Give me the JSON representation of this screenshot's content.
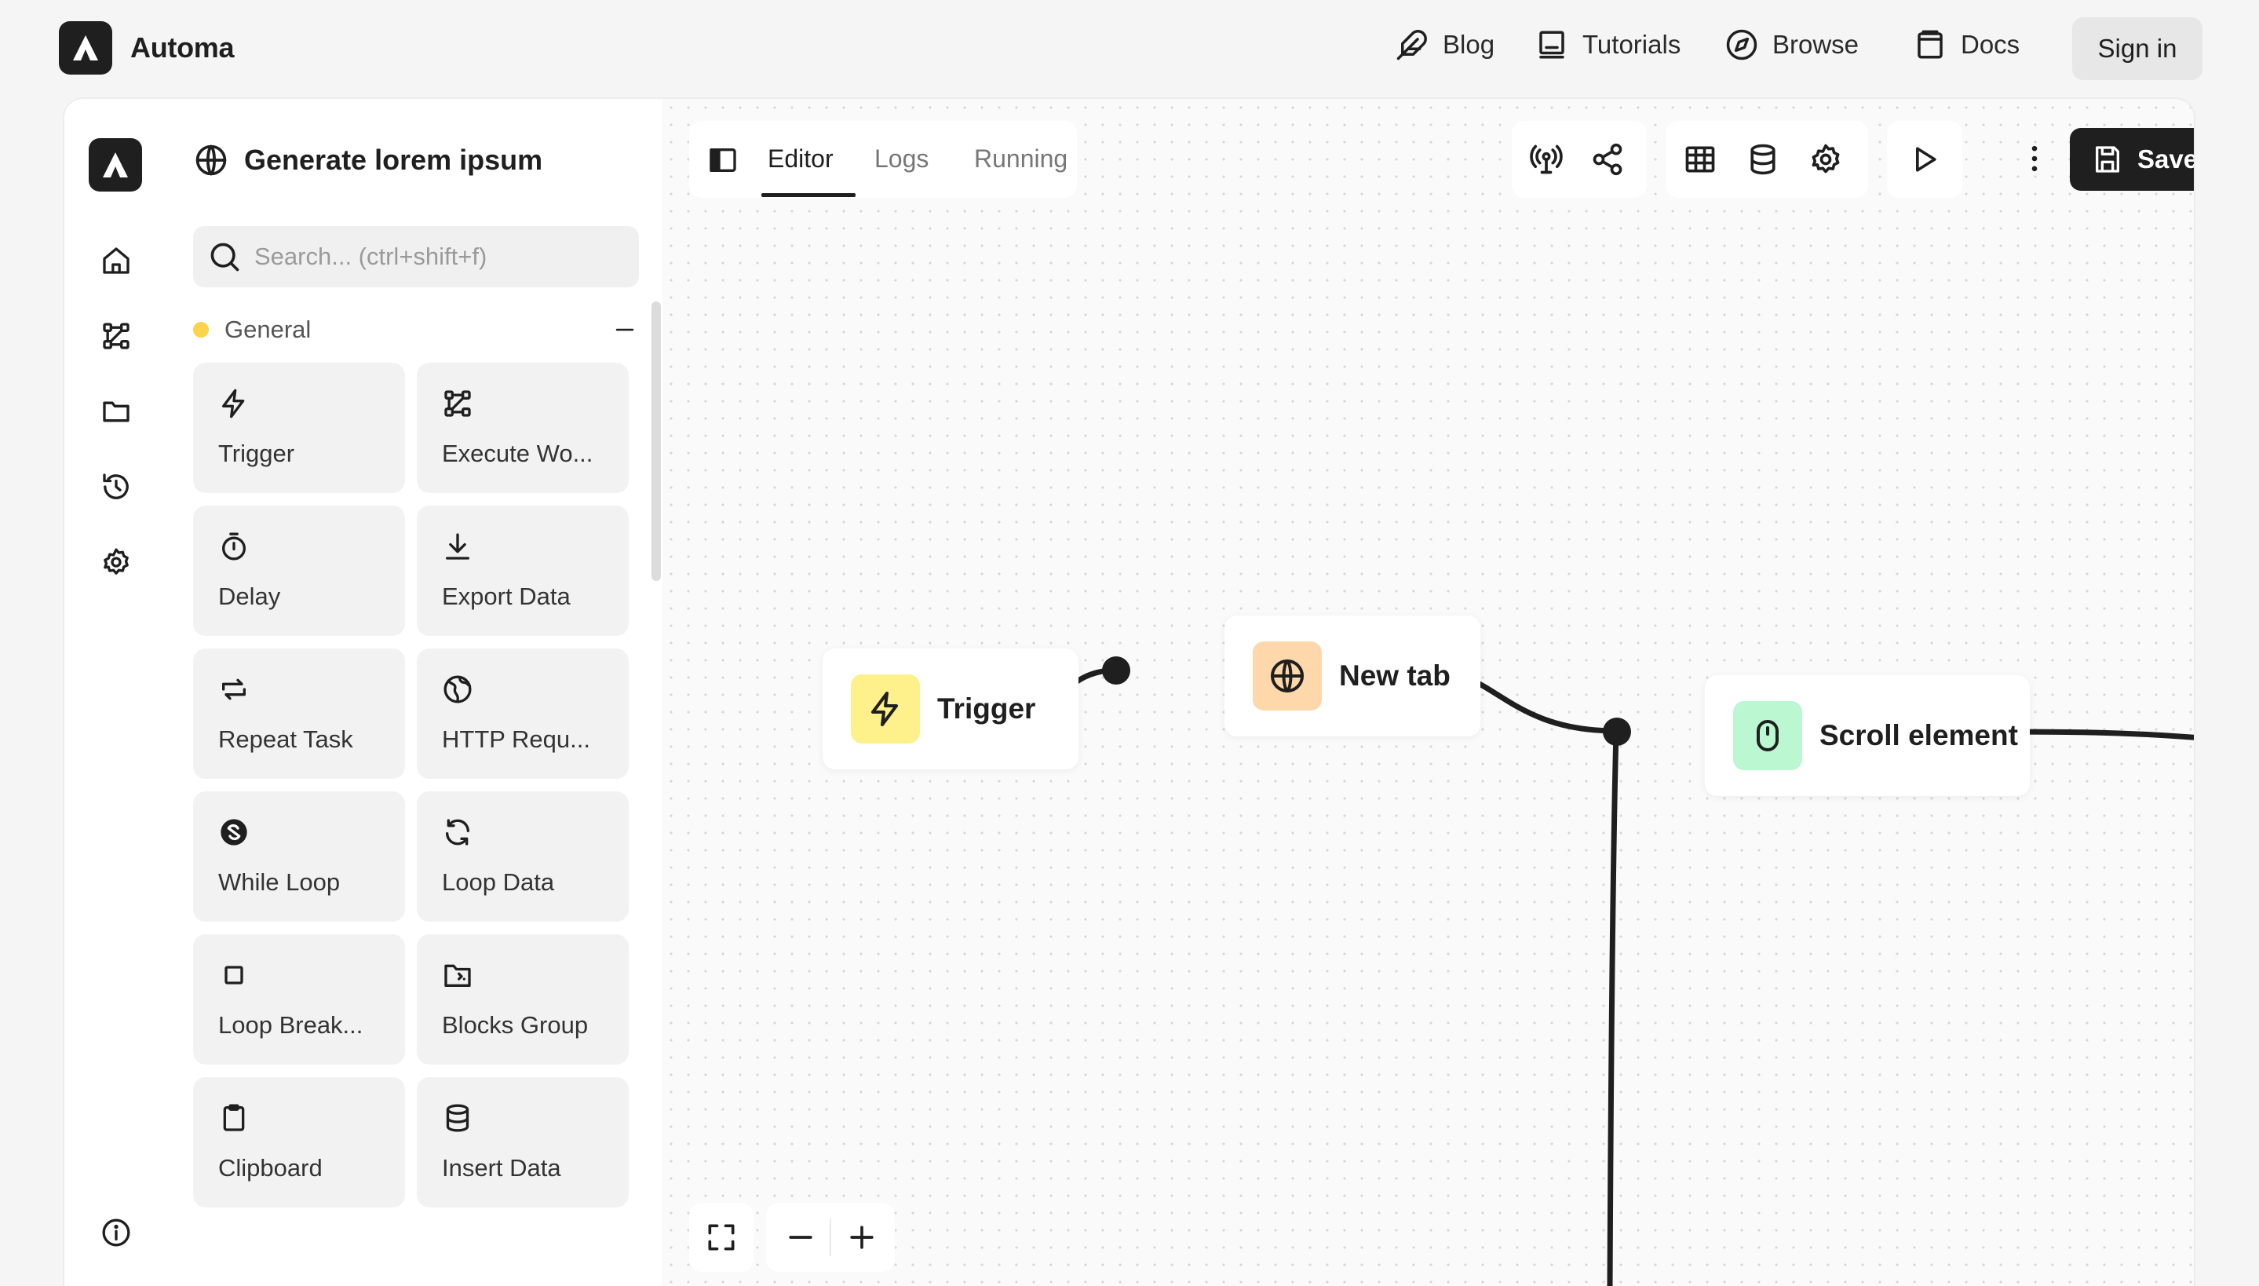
{
  "brand": {
    "name": "Automa"
  },
  "nav": {
    "links": [
      {
        "label": "Blog",
        "icon": "feather-icon"
      },
      {
        "label": "Tutorials",
        "icon": "book-icon"
      },
      {
        "label": "Browse",
        "icon": "compass-icon"
      },
      {
        "label": "Docs",
        "icon": "docs-icon"
      }
    ],
    "signin_label": "Sign in"
  },
  "sidebar": {
    "items": [
      {
        "name": "home",
        "icon": "home-icon"
      },
      {
        "name": "workflows",
        "icon": "workflow-icon"
      },
      {
        "name": "storage",
        "icon": "folder-icon"
      },
      {
        "name": "logs",
        "icon": "history-icon"
      },
      {
        "name": "settings",
        "icon": "gear-icon"
      },
      {
        "name": "about",
        "icon": "info-icon"
      }
    ]
  },
  "workflow": {
    "title": "Generate lorem ipsum"
  },
  "blocks_panel": {
    "search_placeholder": "Search... (ctrl+shift+f)",
    "category": {
      "label": "General",
      "color": "#fcd34d"
    },
    "blocks": [
      {
        "label": "Trigger",
        "icon": "bolt-icon"
      },
      {
        "label": "Execute Wo...",
        "icon": "workflow-icon"
      },
      {
        "label": "Delay",
        "icon": "timer-icon"
      },
      {
        "label": "Export Data",
        "icon": "download-icon"
      },
      {
        "label": "Repeat Task",
        "icon": "repeat-icon"
      },
      {
        "label": "HTTP Requ...",
        "icon": "globe-icon"
      },
      {
        "label": "While Loop",
        "icon": "loop-icon"
      },
      {
        "label": "Loop Data",
        "icon": "refresh-icon"
      },
      {
        "label": "Loop Break...",
        "icon": "stop-icon"
      },
      {
        "label": "Blocks Group",
        "icon": "folder-code-icon"
      },
      {
        "label": "Clipboard",
        "icon": "clipboard-icon"
      },
      {
        "label": "Insert Data",
        "icon": "database-icon"
      }
    ]
  },
  "editor": {
    "tabs": [
      {
        "label": "Editor",
        "active": true
      },
      {
        "label": "Logs",
        "active": false
      },
      {
        "label": "Running",
        "active": false
      }
    ],
    "toolbar": {
      "save_label": "Save",
      "icons": [
        "broadcast-icon",
        "share-icon",
        "table-icon",
        "database-icon",
        "gear-icon",
        "play-icon",
        "more-vertical-icon",
        "save-icon"
      ]
    },
    "nodes": [
      {
        "label": "Trigger",
        "icon": "bolt-icon",
        "color": "#fef08a"
      },
      {
        "label": "New tab",
        "icon": "globe-icon",
        "color": "#fed7aa"
      },
      {
        "label": "Scroll element",
        "icon": "mouse-icon",
        "color": "#bbf7d0"
      }
    ],
    "zoom_controls": [
      "fullscreen-icon",
      "zoom-out-icon",
      "zoom-in-icon"
    ]
  }
}
